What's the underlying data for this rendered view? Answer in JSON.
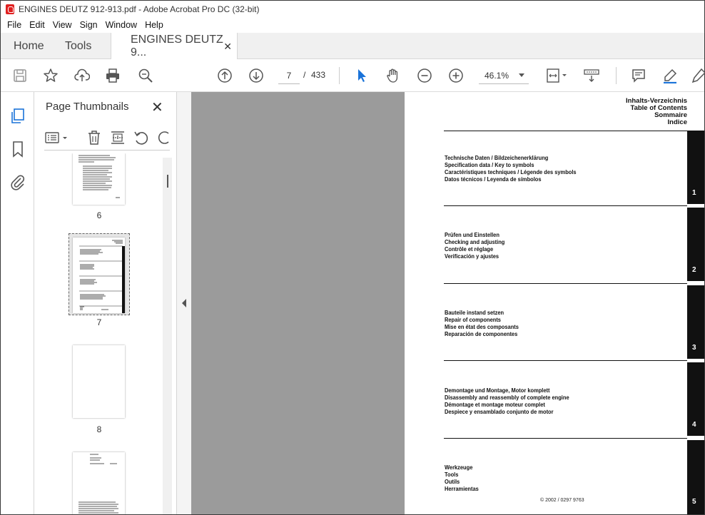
{
  "window": {
    "title": "ENGINES DEUTZ 912-913.pdf - Adobe Acrobat Pro DC (32-bit)"
  },
  "menu": [
    "File",
    "Edit",
    "View",
    "Sign",
    "Window",
    "Help"
  ],
  "tabs": {
    "home": "Home",
    "tools": "Tools",
    "document": "ENGINES DEUTZ 9...",
    "close": "✕"
  },
  "toolbar": {
    "current_page": "7",
    "separator": "/",
    "total_pages": "433",
    "zoom": "46.1%"
  },
  "thumbnails_panel": {
    "title": "Page Thumbnails",
    "close": "✕",
    "pages": [
      {
        "label": "6"
      },
      {
        "label": "7",
        "selected": true
      },
      {
        "label": "8"
      },
      {
        "label": ""
      }
    ]
  },
  "document": {
    "header": [
      "Inhalts-Verzeichnis",
      "Table of Contents",
      "Sommaire",
      "Indice"
    ],
    "sections": [
      {
        "number": "1",
        "lines": [
          "Technische Daten / Bildzeichenerklärung",
          "Specification data / Key to symbols",
          "Caractéristiques techniques / Légende des symbols",
          "Datos técnicos / Leyenda de símbolos"
        ]
      },
      {
        "number": "2",
        "lines": [
          "Prüfen und Einstellen",
          "Checking and adjusting",
          "Contrôle et réglage",
          "Verificación y ajustes"
        ]
      },
      {
        "number": "3",
        "lines": [
          "Bauteile instand setzen",
          "Repair of components",
          "Mise en état des composants",
          "Reparación de componentes"
        ]
      },
      {
        "number": "4",
        "lines": [
          "Demontage und Montage, Motor komplett",
          "Disassembly and reassembly of complete engine",
          "Démontage et montage moteur complet",
          "Despiece y ensamblado conjunto de motor"
        ]
      },
      {
        "number": "5",
        "lines": [
          "Werkzeuge",
          "Tools",
          "Outils",
          "Herramientas"
        ]
      }
    ],
    "copyright": "© 2002 / 0297 9763"
  }
}
